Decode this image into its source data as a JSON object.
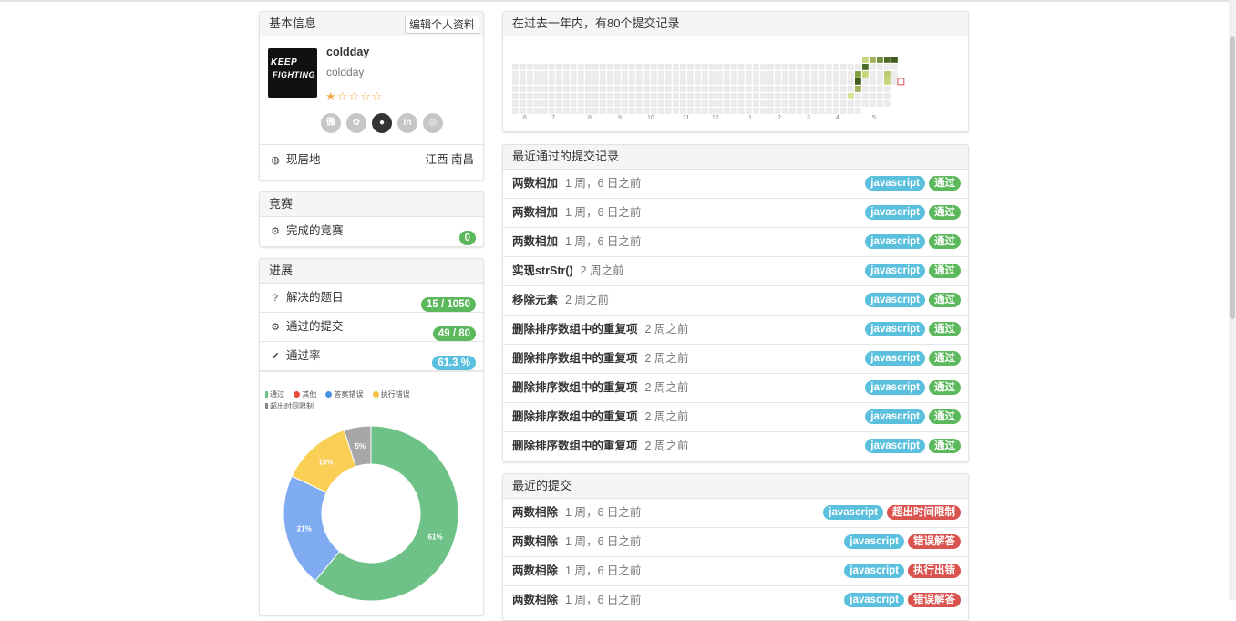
{
  "basic": {
    "title": "基本信息",
    "edit_label": "编辑个人资料",
    "avatar_text": "KEEP FIGHTING",
    "username": "coldday",
    "realname": "coldday",
    "stars": "★☆☆☆☆",
    "rating_stars": 1,
    "socials": [
      "weibo-icon",
      "baidu-icon",
      "github-icon",
      "linkedin-icon",
      "wechat-icon"
    ],
    "location_label": "现居地",
    "location_value": "江西 南昌"
  },
  "contest": {
    "title": "竞赛",
    "row_label": "完成的竞赛",
    "count": "0"
  },
  "progress": {
    "title": "进展",
    "rows": [
      {
        "icon": "question-icon",
        "label": "解决的题目",
        "value": "15 / 1050",
        "color": "#5cb85c"
      },
      {
        "icon": "gear-icon",
        "label": "通过的提交",
        "value": "49 / 80",
        "color": "#5cb85c"
      },
      {
        "icon": "check-icon",
        "label": "通过率",
        "value": "61.3 %",
        "color": "#5bc0de"
      }
    ],
    "legend": [
      {
        "label": "通过",
        "color": "#6fc287"
      },
      {
        "label": "其他",
        "color": "#e74c3c"
      },
      {
        "label": "答案错误",
        "color": "#4a90e2"
      },
      {
        "label": "执行错误",
        "color": "#f5c342"
      },
      {
        "label": "超出时间限制",
        "color": "#888888"
      }
    ]
  },
  "chart_data": {
    "type": "pie",
    "donut": true,
    "labels": [
      "通过",
      "答案错误",
      "执行错误",
      "超出时间限制"
    ],
    "values": [
      61,
      21,
      13,
      5
    ],
    "value_labels": [
      "61%",
      "21%",
      "13%",
      "5%"
    ],
    "colors": [
      "#6fc287",
      "#7facf0",
      "#f9cf55",
      "#a7a7a7"
    ]
  },
  "heatmap": {
    "title": "在过去一年内，有80个提交记录",
    "months": [
      "6",
      "7",
      "8",
      "9",
      "10",
      "11",
      "12",
      "1",
      "2",
      "3",
      "4",
      "5"
    ]
  },
  "accepted": {
    "title": "最近通过的提交记录",
    "rows": [
      {
        "name": "两数相加",
        "time": "1 周，6 日之前",
        "lang": "javascript",
        "status": "通过"
      },
      {
        "name": "两数相加",
        "time": "1 周，6 日之前",
        "lang": "javascript",
        "status": "通过"
      },
      {
        "name": "两数相加",
        "time": "1 周，6 日之前",
        "lang": "javascript",
        "status": "通过"
      },
      {
        "name": "实现strStr()",
        "time": "2 周之前",
        "lang": "javascript",
        "status": "通过"
      },
      {
        "name": "移除元素",
        "time": "2 周之前",
        "lang": "javascript",
        "status": "通过"
      },
      {
        "name": "删除排序数组中的重复项",
        "time": "2 周之前",
        "lang": "javascript",
        "status": "通过"
      },
      {
        "name": "删除排序数组中的重复项",
        "time": "2 周之前",
        "lang": "javascript",
        "status": "通过"
      },
      {
        "name": "删除排序数组中的重复项",
        "time": "2 周之前",
        "lang": "javascript",
        "status": "通过"
      },
      {
        "name": "删除排序数组中的重复项",
        "time": "2 周之前",
        "lang": "javascript",
        "status": "通过"
      },
      {
        "name": "删除排序数组中的重复项",
        "time": "2 周之前",
        "lang": "javascript",
        "status": "通过"
      }
    ]
  },
  "recent": {
    "title": "最近的提交",
    "rows": [
      {
        "name": "两数相除",
        "time": "1 周，6 日之前",
        "lang": "javascript",
        "status": "超出时间限制"
      },
      {
        "name": "两数相除",
        "time": "1 周，6 日之前",
        "lang": "javascript",
        "status": "错误解答"
      },
      {
        "name": "两数相除",
        "time": "1 周，6 日之前",
        "lang": "javascript",
        "status": "执行出错"
      },
      {
        "name": "两数相除",
        "time": "1 周，6 日之前",
        "lang": "javascript",
        "status": "错误解答"
      }
    ]
  }
}
